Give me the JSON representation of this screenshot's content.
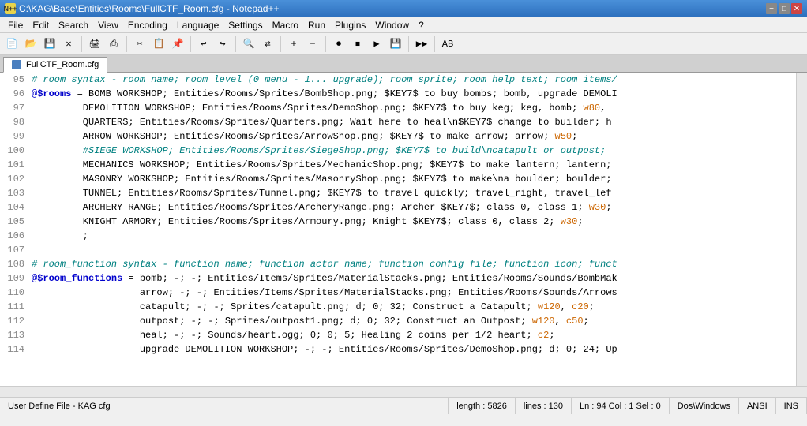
{
  "window": {
    "title": "C:\\KAG\\Base\\Entities\\Rooms\\FullCTF_Room.cfg - Notepad++",
    "icon": "N++"
  },
  "titlebar": {
    "min_label": "−",
    "max_label": "□",
    "close_label": "✕"
  },
  "menu": {
    "items": [
      "File",
      "Edit",
      "Search",
      "View",
      "Encoding",
      "Language",
      "Settings",
      "Macro",
      "Run",
      "Plugins",
      "Window",
      "?"
    ]
  },
  "tab": {
    "label": "FullCTF_Room.cfg"
  },
  "editor": {
    "lines": [
      {
        "num": "95",
        "content_html": "<span class='c-hash'># room syntax - room name; room level (0 menu - 1... upgrade); room sprite; room help text; room items/</span>"
      },
      {
        "num": "96",
        "content_html": "<span class='c-variable'>@$rooms</span><span class='c-normal'> = BOMB WORKSHOP; Entities/Rooms/Sprites/BombShop.png; $KEY7$ to buy bombs; bomb, upgrade DEMOLI</span>"
      },
      {
        "num": "97",
        "content_html": "<span class='c-normal'>         DEMOLITION WORKSHOP; Entities/Rooms/Sprites/DemoShop.png; $KEY7$ to buy keg; keg, bomb; </span><span class='c-number'>w80</span><span class='c-normal'>,</span>"
      },
      {
        "num": "98",
        "content_html": "<span class='c-normal'>         QUARTERS; Entities/Rooms/Sprites/Quarters.png; Wait here to heal\\n$KEY7$ change to builder; h</span>"
      },
      {
        "num": "99",
        "content_html": "<span class='c-normal'>         ARROW WORKSHOP; Entities/Rooms/Sprites/ArrowShop.png; $KEY7$ to make arrow; arrow; </span><span class='c-number'>w50</span><span class='c-normal'>;</span>"
      },
      {
        "num": "100",
        "content_html": "<span class='c-hash'>         #SIEGE WORKSHOP; Entities/Rooms/Sprites/SiegeShop.png; $KEY7$ to build\\ncatapult or outpost;</span>"
      },
      {
        "num": "101",
        "content_html": "<span class='c-normal'>         MECHANICS WORKSHOP; Entities/Rooms/Sprites/MechanicShop.png; $KEY7$ to make lantern; lantern;</span>"
      },
      {
        "num": "102",
        "content_html": "<span class='c-normal'>         MASONRY WORKSHOP; Entities/Rooms/Sprites/MasonryShop.png; $KEY7$ to make\\na boulder; boulder;</span>"
      },
      {
        "num": "103",
        "content_html": "<span class='c-normal'>         TUNNEL; Entities/Rooms/Sprites/Tunnel.png; $KEY7$ to travel quickly; travel_right, travel_lef</span>"
      },
      {
        "num": "104",
        "content_html": "<span class='c-normal'>         ARCHERY RANGE; Entities/Rooms/Sprites/ArcheryRange.png; Archer $KEY7$; class 0, class 1; </span><span class='c-number'>w30</span><span class='c-normal'>;</span>"
      },
      {
        "num": "105",
        "content_html": "<span class='c-normal'>         KNIGHT ARMORY; Entities/Rooms/Sprites/Armoury.png; Knight $KEY7$; class 0, class 2; </span><span class='c-number'>w30</span><span class='c-normal'>;</span>"
      },
      {
        "num": "106",
        "content_html": "<span class='c-normal'>         ;</span>"
      },
      {
        "num": "107",
        "content_html": ""
      },
      {
        "num": "108",
        "content_html": "<span class='c-hash'># room_function syntax - function name; function actor name; function config file; function icon; funct</span>"
      },
      {
        "num": "109",
        "content_html": "<span class='c-variable'>@$room_functions</span><span class='c-normal'> = bomb; -; -; Entities/Items/Sprites/MaterialStacks.png; Entities/Rooms/Sounds/BombMak</span>"
      },
      {
        "num": "110",
        "content_html": "<span class='c-normal'>                   arrow; -; -; Entities/Items/Sprites/MaterialStacks.png; Entities/Rooms/Sounds/Arrows</span>"
      },
      {
        "num": "111",
        "content_html": "<span class='c-normal'>                   catapult; -; -; Sprites/catapult.png; d; 0; 32; Construct a Catapult; </span><span class='c-number'>w120</span><span class='c-normal'>, </span><span class='c-number'>c20</span><span class='c-normal'>;</span>"
      },
      {
        "num": "112",
        "content_html": "<span class='c-normal'>                   outpost; -; -; Sprites/outpost1.png; d; 0; 32; Construct an Outpost; </span><span class='c-number'>w120</span><span class='c-normal'>, </span><span class='c-number'>c50</span><span class='c-normal'>;</span>"
      },
      {
        "num": "113",
        "content_html": "<span class='c-normal'>                   heal; -; -; Sounds/heart.ogg; 0; 0; 5; Healing 2 coins per 1/2 heart; </span><span class='c-number'>c2</span><span class='c-normal'>;</span>"
      },
      {
        "num": "114",
        "content_html": "<span class='c-normal'>                   upgrade DEMOLITION WORKSHOP; -; -; Entities/Rooms/Sprites/DemoShop.png; d; 0; 24; Up</span>"
      }
    ]
  },
  "status": {
    "file_type": "User Define File - KAG cfg",
    "length": "length : 5826",
    "lines": "lines : 130",
    "cursor": "Ln : 94   Col : 1   Sel : 0",
    "line_ending": "Dos\\Windows",
    "encoding": "ANSI",
    "mode": "INS"
  }
}
